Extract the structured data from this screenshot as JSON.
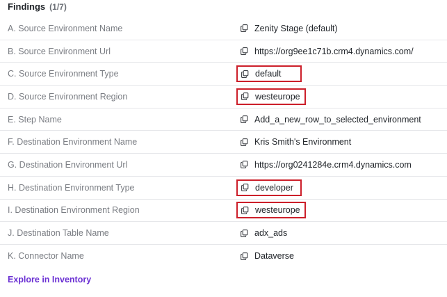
{
  "findings": {
    "title": "Findings",
    "count": "(1/7)"
  },
  "rows": [
    {
      "label": "A. Source Environment Name",
      "value": "Zenity Stage (default)",
      "highlighted": false
    },
    {
      "label": "B. Source Environment Url",
      "value": "https://org9ee1c71b.crm4.dynamics.com/",
      "highlighted": false
    },
    {
      "label": "C. Source Environment Type",
      "value": "default",
      "highlighted": true
    },
    {
      "label": "D. Source Environment Region",
      "value": "westeurope",
      "highlighted": true
    },
    {
      "label": "E. Step Name",
      "value": "Add_a_new_row_to_selected_environment",
      "highlighted": false
    },
    {
      "label": "F. Destination Environment Name",
      "value": "Kris Smith's Environment",
      "highlighted": false
    },
    {
      "label": "G. Destination Environment Url",
      "value": "https://org0241284e.crm4.dynamics.com",
      "highlighted": false
    },
    {
      "label": "H. Destination Environment Type",
      "value": "developer",
      "highlighted": true
    },
    {
      "label": "I. Destination Environment Region",
      "value": "westeurope",
      "highlighted": true
    },
    {
      "label": "J. Destination Table Name",
      "value": "adx_ads",
      "highlighted": false
    },
    {
      "label": "K. Connector Name",
      "value": "Dataverse",
      "highlighted": false
    }
  ],
  "icons": {
    "copy": "copy-icon"
  },
  "colors": {
    "highlight_border": "#cc1f2a",
    "link": "#6a2fd3",
    "label": "#7a7d83"
  },
  "explore_link": "Explore in Inventory"
}
